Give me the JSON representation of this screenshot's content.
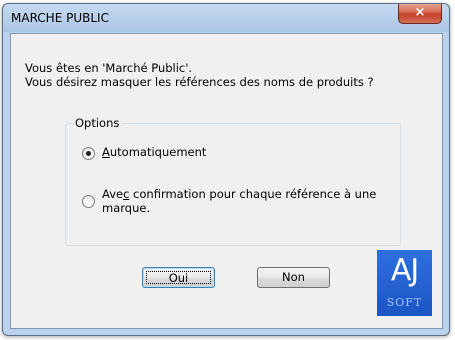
{
  "window": {
    "title": "MARCHE PUBLIC",
    "close_glyph": "×"
  },
  "message": {
    "line1": "Vous êtes en 'Marché Public'.",
    "line2": "Vous désirez masquer les références des noms de produits ?"
  },
  "options": {
    "group_label": "Options",
    "radio_auto": {
      "label_hotkey": "A",
      "label_rest": "utomatiquement",
      "selected": true
    },
    "radio_confirm": {
      "label_pre": "Ave",
      "label_hotkey": "c",
      "label_rest_line1": " confirmation pour chaque référence à une",
      "label_line2": "marque.",
      "selected": false
    }
  },
  "buttons": {
    "yes": "Oui",
    "no": "Non"
  },
  "logo": {
    "main": "AJ",
    "sub": "SOFT",
    "color": "#2566d6"
  },
  "icons": {
    "close": "close-icon",
    "logo": "aj-soft-logo"
  }
}
